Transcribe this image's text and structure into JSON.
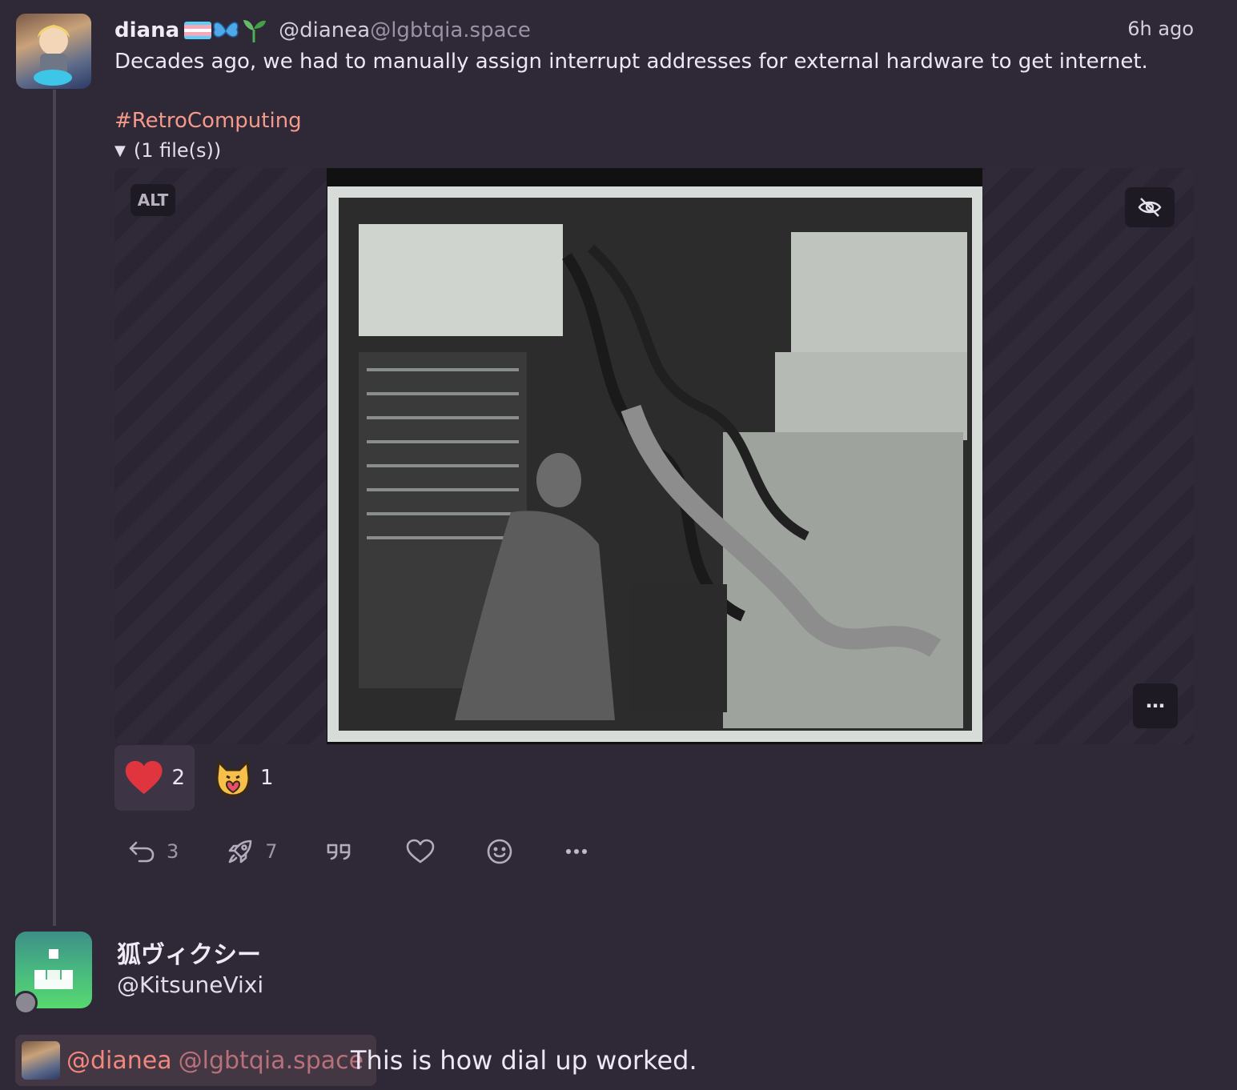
{
  "post": {
    "display_name": "diana",
    "name_emojis": [
      "trans-flag",
      "butterfly",
      "seedling"
    ],
    "username": "@dianea",
    "host": "@lgbtqia.space",
    "timestamp": "6h ago",
    "text": "Decades ago, we had to manually assign interrupt addresses for external hardware to get internet.",
    "hashtag": "#RetroComputing",
    "files_toggle": "(1 file(s))",
    "media": {
      "alt_badge": "ALT",
      "hide_icon": "eye-off-icon",
      "more_label": "⋯"
    },
    "reactions": [
      {
        "emoji": "heart",
        "count": "2",
        "active": true
      },
      {
        "emoji": "cat-heart-hug",
        "count": "1",
        "active": false
      }
    ],
    "actions": {
      "reply_count": "3",
      "boost_count": "7",
      "quote_icon": "quote-icon",
      "like_icon": "heart-outline-icon",
      "react_icon": "smiley-icon",
      "more_icon": "more-icon"
    }
  },
  "reply": {
    "display_name": "狐ヴィクシー",
    "handle": "@KitsuneVixi",
    "mention_user": "@dianea",
    "mention_host": "@lgbtqia.space",
    "text": "This is how dial up worked."
  },
  "colors": {
    "background": "#2e2837",
    "hashtag": "#f59a8a",
    "mention": "#f1877d",
    "heart": "#e0343f"
  }
}
